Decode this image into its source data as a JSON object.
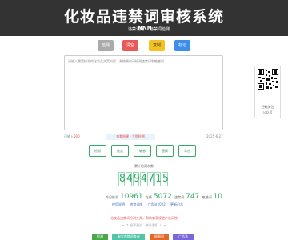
{
  "header": {
    "title": "化妆品违禁词审核系统",
    "brand_text": "违禁词网",
    "logo_text": "NNN",
    "link_text": "违禁词检测"
  },
  "toolbar": {
    "tool1": "检测",
    "tool2": "清空",
    "tool3": "复制",
    "tool4": "标记"
  },
  "editor": {
    "placeholder": "请输入需要检测的化妆品文案内容，系统将自动检测违禁词和敏感词"
  },
  "sidebar": {
    "qr_caption": "扫码关注",
    "qr_sub": "公众号"
  },
  "counter": {
    "label": "已输入",
    "value": "500"
  },
  "notice": "查看结果 · 立即检测",
  "date": "2025-6-27",
  "actions": [
    "检测",
    "违禁",
    "敏感",
    "替换",
    "导出"
  ],
  "stats": {
    "title": "累计检测次数",
    "digits": [
      "8",
      "4",
      "9",
      "4",
      "7",
      "1",
      "5"
    ],
    "label1": "今日检测",
    "value1": "10961",
    "label2": "在线",
    "value2": "5072",
    "label3": "违禁词",
    "value3": "747",
    "label4": "敏感词",
    "value4": "10"
  },
  "links": [
    "使用说明",
    "违禁词库",
    "广告法2022",
    "更新日志"
  ],
  "promo": {
    "line1": "化妆品违禁词检测工具，帮助商家规避广告风险",
    "line2": "← ↑ 投诉建议 · 联系我们 ↓ →"
  },
  "bottom": {
    "b1": "检测",
    "b2": "淘宝违禁词查询",
    "b3": "极限词",
    "b4": "广告法"
  }
}
